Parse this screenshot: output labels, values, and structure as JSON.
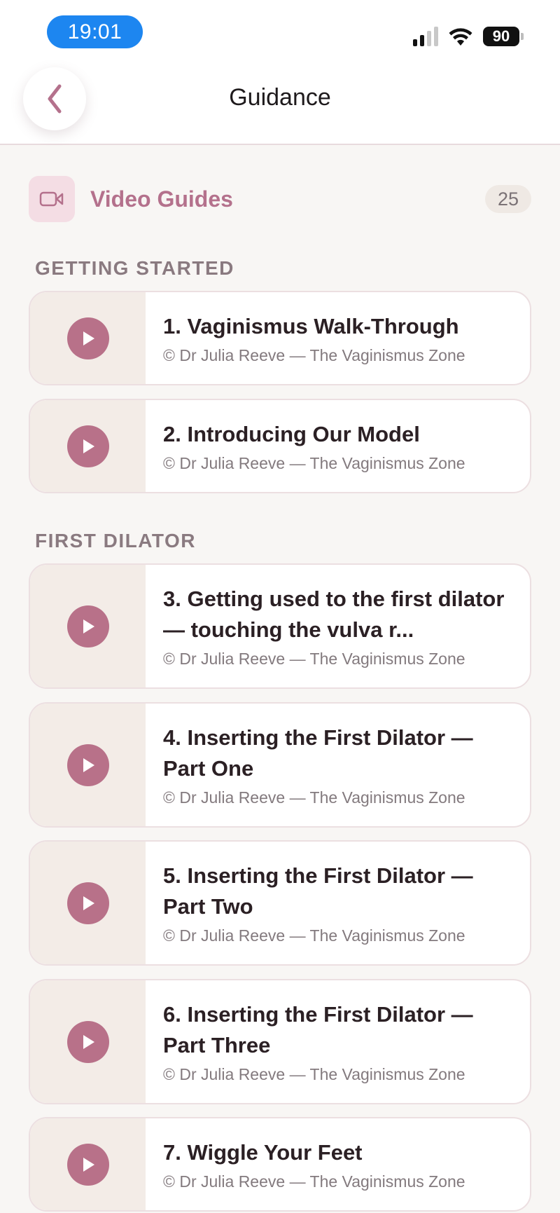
{
  "status_bar": {
    "time": "19:01",
    "battery": "90",
    "signal_icon": "cellular-signal-icon",
    "wifi_icon": "wifi-icon"
  },
  "header": {
    "title": "Guidance",
    "back_icon": "chevron-left-icon"
  },
  "guides": {
    "icon": "video-camera-icon",
    "title": "Video Guides",
    "count": "25"
  },
  "sections": [
    {
      "label": "GETTING STARTED",
      "videos": [
        {
          "title": "1. Vaginismus Walk-Through",
          "credit": "© Dr Julia Reeve — The Vaginismus Zone"
        },
        {
          "title": "2. Introducing Our Model",
          "credit": "© Dr Julia Reeve — The Vaginismus Zone"
        }
      ]
    },
    {
      "label": "FIRST DILATOR",
      "videos": [
        {
          "title": "3. Getting used to the first dilator — touching the vulva r...",
          "credit": "© Dr Julia Reeve — The Vaginismus Zone"
        },
        {
          "title": "4. Inserting the First Dilator — Part One",
          "credit": "© Dr Julia Reeve — The Vaginismus Zone"
        },
        {
          "title": "5. Inserting the First Dilator — Part Two",
          "credit": "© Dr Julia Reeve — The Vaginismus Zone"
        },
        {
          "title": "6. Inserting the First Dilator — Part Three",
          "credit": "© Dr Julia Reeve — The Vaginismus Zone"
        },
        {
          "title": "7. Wiggle Your Feet",
          "credit": "© Dr Julia Reeve — The Vaginismus Zone"
        }
      ]
    }
  ],
  "colors": {
    "accent": "#b87189",
    "accent_text": "#b4718c",
    "background": "#f8f6f4",
    "thumb_bg": "#f3ece7"
  }
}
